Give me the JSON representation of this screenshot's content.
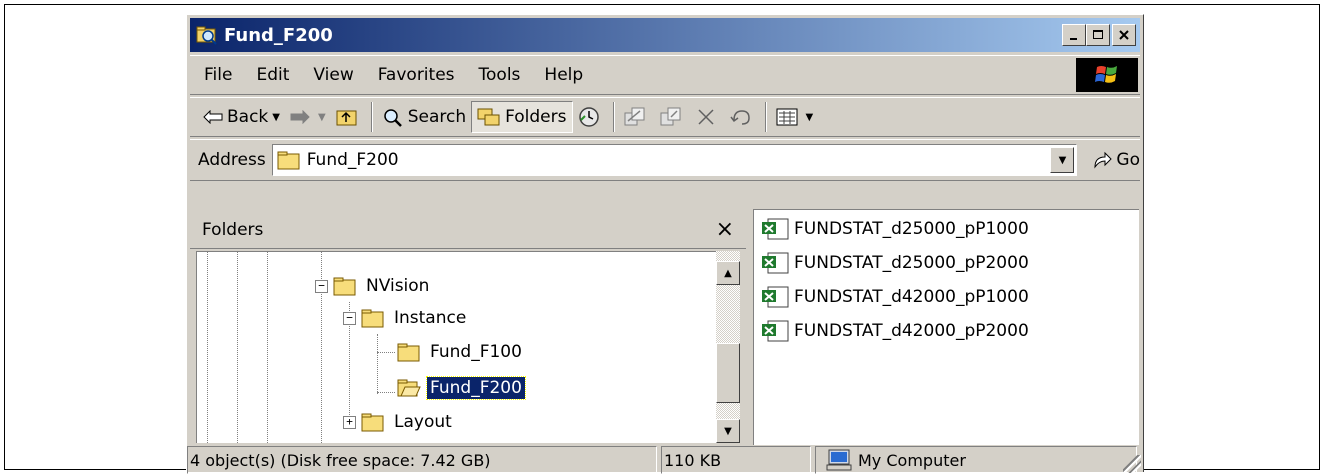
{
  "window": {
    "title": "Fund_F200"
  },
  "menu": [
    "File",
    "Edit",
    "View",
    "Favorites",
    "Tools",
    "Help"
  ],
  "toolbar": {
    "back_label": "Back",
    "search_label": "Search",
    "folders_label": "Folders"
  },
  "address": {
    "label": "Address",
    "value": "Fund_F200",
    "go_label": "Go"
  },
  "folders_pane": {
    "header": "Folders",
    "close": "×",
    "tree": {
      "nvision": "NVision",
      "instance": "Instance",
      "fund_f100": "Fund_F100",
      "fund_f200": "Fund_F200",
      "layout": "Layout"
    }
  },
  "files": [
    "FUNDSTAT_d25000_pP1000",
    "FUNDSTAT_d25000_pP2000",
    "FUNDSTAT_d42000_pP1000",
    "FUNDSTAT_d42000_pP2000"
  ],
  "status": {
    "objects": "4 object(s) (Disk free space: 7.42 GB)",
    "size": "110 KB",
    "zone": "My Computer"
  },
  "colors": {
    "titlebar_start": "#0a246a",
    "titlebar_end": "#a6caf0",
    "face": "#d4d0c8",
    "selection": "#0a246a",
    "excel_green": "#1f7a2e"
  }
}
